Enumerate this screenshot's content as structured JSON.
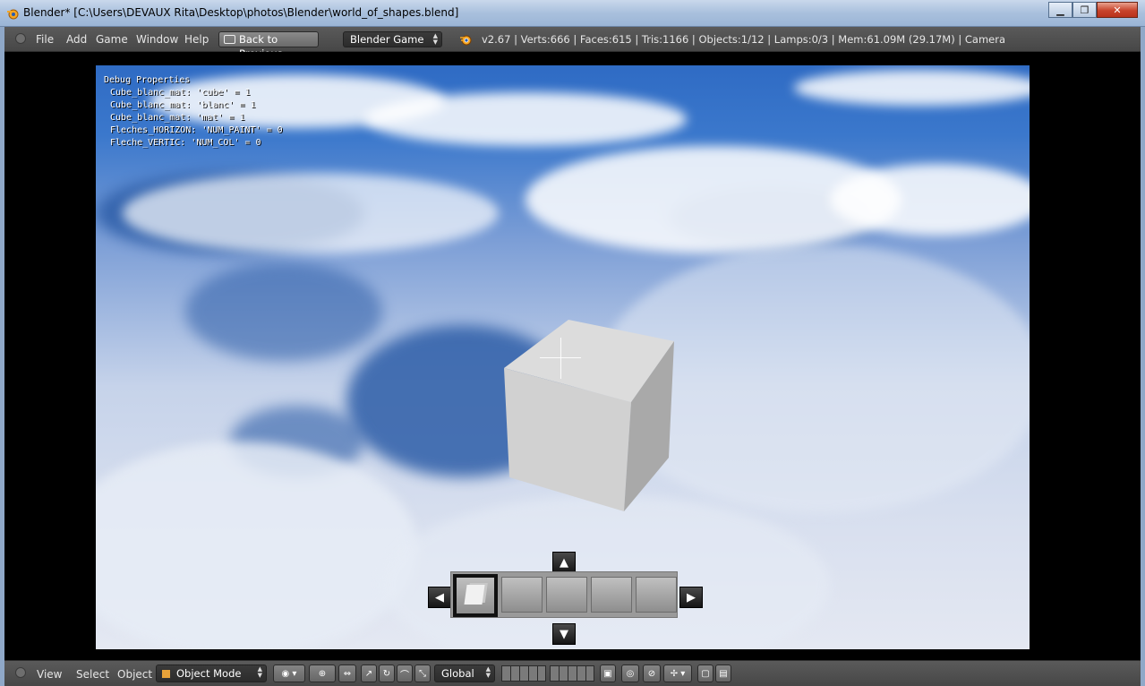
{
  "window": {
    "title": "Blender* [C:\\Users\\DEVAUX Rita\\Desktop\\photos\\Blender\\world_of_shapes.blend]",
    "minimize": "▁",
    "maximize": "❐",
    "close": "✕"
  },
  "menubar": {
    "items": [
      "File",
      "Add",
      "Game",
      "Window",
      "Help"
    ],
    "back_label": "Back to Previous",
    "engine": "Blender Game",
    "stats": "v2.67 | Verts:666 | Faces:615 | Tris:1166 | Objects:1/12 | Lamps:0/3 | Mem:61.09M (29.17M) | Camera"
  },
  "debug": {
    "header": "Debug Properties",
    "lines": [
      "Cube_blanc_mat: 'cube' = 1",
      "Cube_blanc_mat: 'blanc' = 1",
      "Cube_blanc_mat: 'mat' = 1",
      "Fleches_HORIZON: 'NUM_PAINT' = 0",
      "Fleche_VERTIC: 'NUM_COL' = 0"
    ]
  },
  "inventory": {
    "up": "▲",
    "down": "▼",
    "left": "◀",
    "right": "▶"
  },
  "footer": {
    "menus": [
      "View",
      "Select",
      "Object"
    ],
    "mode": "Object Mode",
    "orientation": "Global"
  },
  "colors": {
    "sky_blue": "#2f6bc4",
    "header_gray": "#4f4f4f",
    "close_red": "#c8432b"
  }
}
